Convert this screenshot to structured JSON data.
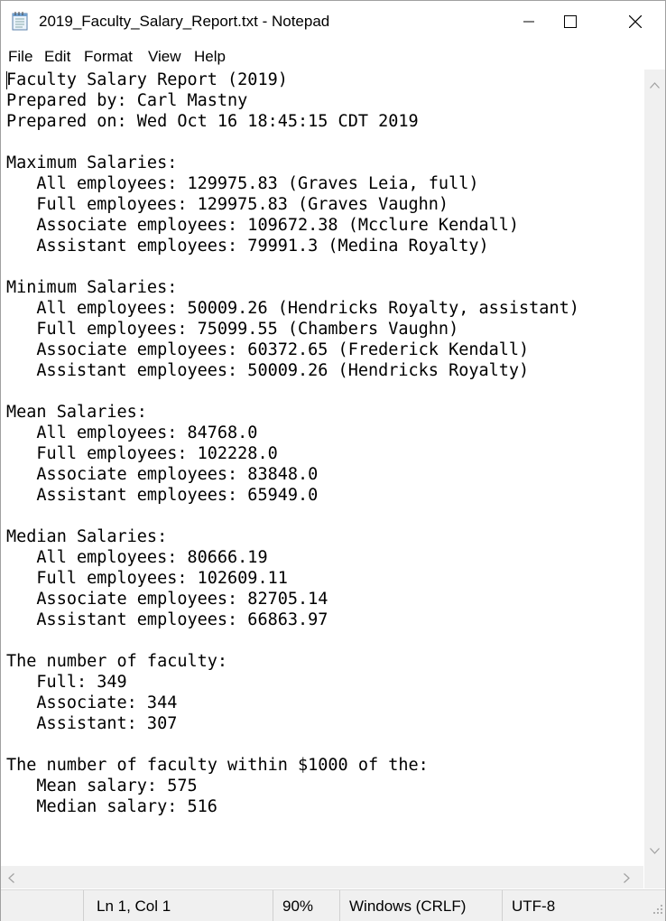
{
  "window": {
    "title": "2019_Faculty_Salary_Report.txt - Notepad",
    "app_icon": "notepad-icon",
    "controls": [
      "minimize-icon",
      "maximize-icon",
      "close-icon"
    ]
  },
  "menu": {
    "file": "File",
    "edit": "Edit",
    "format": "Format",
    "view": "View",
    "help": "Help"
  },
  "document": {
    "content": "Faculty Salary Report (2019)\nPrepared by: Carl Mastny\nPrepared on: Wed Oct 16 18:45:15 CDT 2019\n\nMaximum Salaries:\n   All employees: 129975.83 (Graves Leia, full)\n   Full employees: 129975.83 (Graves Vaughn)\n   Associate employees: 109672.38 (Mcclure Kendall)\n   Assistant employees: 79991.3 (Medina Royalty)\n\nMinimum Salaries:\n   All employees: 50009.26 (Hendricks Royalty, assistant)\n   Full employees: 75099.55 (Chambers Vaughn)\n   Associate employees: 60372.65 (Frederick Kendall)\n   Assistant employees: 50009.26 (Hendricks Royalty)\n\nMean Salaries:\n   All employees: 84768.0\n   Full employees: 102228.0\n   Associate employees: 83848.0\n   Assistant employees: 65949.0\n\nMedian Salaries:\n   All employees: 80666.19\n   Full employees: 102609.11\n   Associate employees: 82705.14\n   Assistant employees: 66863.97\n\nThe number of faculty:\n   Full: 349\n   Associate: 344\n   Assistant: 307\n\nThe number of faculty within $1000 of the:\n   Mean salary: 575\n   Median salary: 516"
  },
  "status": {
    "position": "Ln 1, Col 1",
    "zoom": "90%",
    "line_endings": "Windows (CRLF)",
    "encoding": "UTF-8"
  },
  "colors": {
    "chrome": "#f0f0f0",
    "text": "#000000",
    "background": "#ffffff"
  }
}
